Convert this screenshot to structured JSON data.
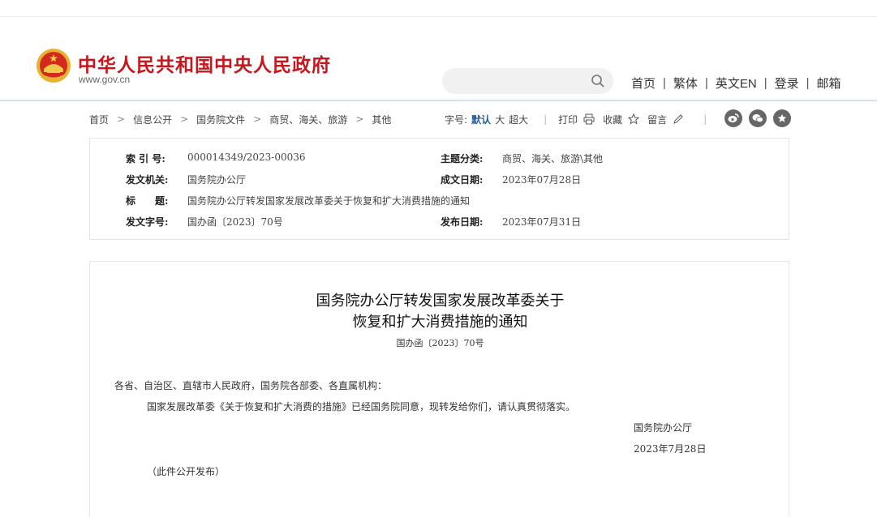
{
  "site": {
    "title": "中华人民共和国中央人民政府",
    "domain": "www.gov.cn"
  },
  "top_nav": {
    "home": "首页",
    "traditional": "繁体",
    "english": "英文EN",
    "login": "登录",
    "mail": "邮箱",
    "separator": "|"
  },
  "search": {
    "placeholder": ""
  },
  "breadcrumb": {
    "items": [
      "首页",
      "信息公开",
      "国务院文件",
      "商贸、海关、旅游",
      "其他"
    ],
    "arrow": ">"
  },
  "tools": {
    "font_label": "字号:",
    "font_default": "默认",
    "font_large": "大",
    "font_xlarge": "超大",
    "separator": "|",
    "print": "打印",
    "favorite": "收藏",
    "comment": "留言"
  },
  "meta": {
    "index_label": "索 引 号:",
    "index_value": "000014349/2023-00036",
    "topic_label": "主题分类:",
    "topic_value": "商贸、海关、旅游\\其他",
    "issuer_label": "发文机关:",
    "issuer_value": "国务院办公厅",
    "written_label": "成文日期:",
    "written_value": "2023年07月28日",
    "title_label": "标　　题:",
    "title_value": "国务院办公厅转发国家发展改革委关于恢复和扩大消费措施的通知",
    "docno_label": "发文字号:",
    "docno_value": "国办函〔2023〕70号",
    "published_label": "发布日期:",
    "published_value": "2023年07月31日"
  },
  "article": {
    "title_line1": "国务院办公厅转发国家发展改革委关于",
    "title_line2": "恢复和扩大消费措施的通知",
    "doc_number": "国办函〔2023〕70号",
    "salutation": "各省、自治区、直辖市人民政府，国务院各部委、各直属机构：",
    "body": "国家发展改革委《关于恢复和扩大消费的措施》已经国务院同意，现转发给你们，请认真贯彻落实。",
    "signature": "国务院办公厅",
    "date": "2023年7月28日",
    "note": "（此件公开发布）"
  },
  "colors": {
    "brand_red": "#c8161d",
    "link_blue": "#2a5a9a"
  }
}
